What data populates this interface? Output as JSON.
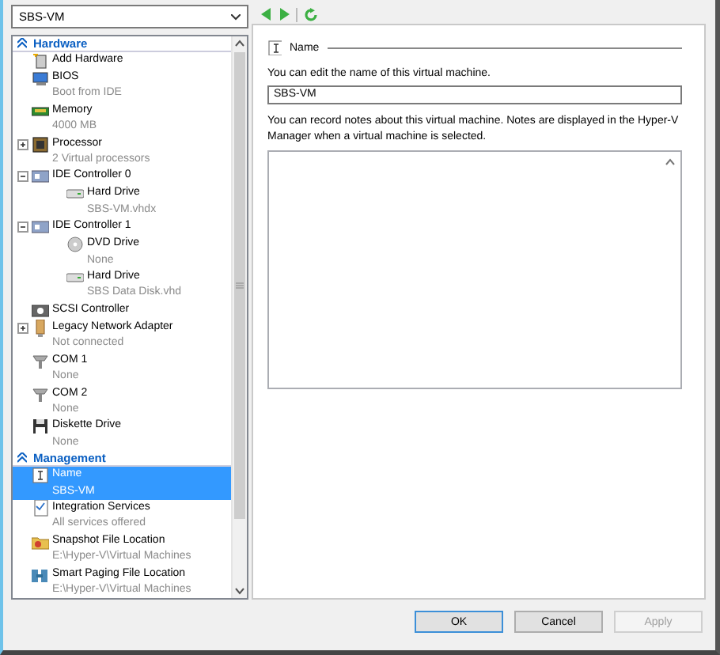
{
  "vm_selector": {
    "value": "SBS-VM"
  },
  "tree": [
    {
      "heading": "Hardware",
      "items": [
        {
          "kind": "add-hardware",
          "title": "Add Hardware",
          "selected": false
        },
        {
          "kind": "bios",
          "title": "BIOS",
          "detail": "Boot from IDE",
          "selected": false
        },
        {
          "kind": "memory",
          "title": "Memory",
          "detail": "4000 MB",
          "selected": false
        },
        {
          "kind": "processor",
          "title": "Processor",
          "detail": "2 Virtual processors",
          "expanded": false,
          "selected": false
        },
        {
          "kind": "controller",
          "title": "IDE Controller 0",
          "expanded": true,
          "selected": false,
          "children": [
            {
              "kind": "disk",
              "title": "Hard Drive",
              "detail": "SBS-VM.vhdx",
              "selected": false
            }
          ]
        },
        {
          "kind": "controller",
          "title": "IDE Controller 1",
          "expanded": true,
          "selected": false,
          "children": [
            {
              "kind": "dvd",
              "title": "DVD Drive",
              "detail": "None",
              "selected": false
            },
            {
              "kind": "disk",
              "title": "Hard Drive",
              "detail": "SBS Data Disk.vhd",
              "selected": false
            }
          ]
        },
        {
          "kind": "scsi",
          "title": "SCSI Controller",
          "selected": false
        },
        {
          "kind": "network",
          "title": "Legacy Network Adapter",
          "detail": "Not connected",
          "expanded": false,
          "selected": false
        },
        {
          "kind": "port",
          "title": "COM 1",
          "detail": "None",
          "selected": false
        },
        {
          "kind": "port",
          "title": "COM 2",
          "detail": "None",
          "selected": false
        },
        {
          "kind": "floppy",
          "title": "Diskette Drive",
          "detail": "None",
          "selected": false
        }
      ]
    },
    {
      "heading": "Management",
      "items": [
        {
          "kind": "name",
          "title": "Name",
          "detail": "SBS-VM",
          "selected": true
        },
        {
          "kind": "integration",
          "title": "Integration Services",
          "detail": "All services offered",
          "selected": false
        },
        {
          "kind": "folder",
          "title": "Snapshot File Location",
          "detail": "E:\\Hyper-V\\Virtual Machines",
          "selected": false
        },
        {
          "kind": "paging",
          "title": "Smart Paging File Location",
          "detail": "E:\\Hyper-V\\Virtual Machines",
          "selected": false
        }
      ]
    }
  ],
  "panel": {
    "title": "Name",
    "name_hint": "You can edit the name of this virtual machine.",
    "name_value": "SBS-VM",
    "notes_hint": "You can record notes about this virtual machine. Notes are displayed in the Hyper-V Manager when a virtual machine is selected."
  },
  "buttons": [
    {
      "label": "OK",
      "default": true,
      "disabled": false
    },
    {
      "label": "Cancel",
      "default": false,
      "disabled": false
    },
    {
      "label": "Apply",
      "default": false,
      "disabled": true
    }
  ]
}
